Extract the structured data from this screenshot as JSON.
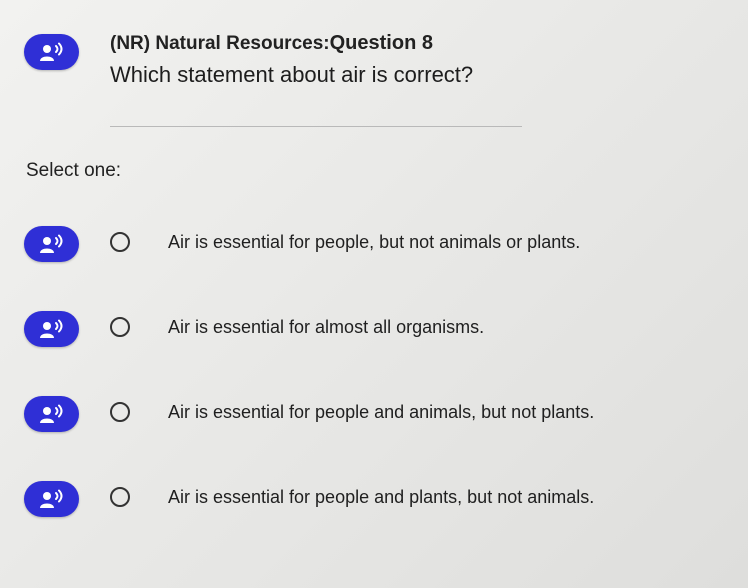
{
  "question": {
    "category": "(NR) Natural Resources:",
    "number_label": "Question 8",
    "text": "Which statement about air is correct?",
    "audio_icon": "speaker-person-icon"
  },
  "select_label": "Select one:",
  "options": [
    {
      "text": "Air is essential for people, but not animals or plants.",
      "selected": false
    },
    {
      "text": "Air is essential for almost all organisms.",
      "selected": false
    },
    {
      "text": "Air is essential for people and animals, but not plants.",
      "selected": false
    },
    {
      "text": "Air is essential for people and plants, but not animals.",
      "selected": false
    }
  ],
  "colors": {
    "accent": "#2f2fd6",
    "background": "#ececea"
  }
}
